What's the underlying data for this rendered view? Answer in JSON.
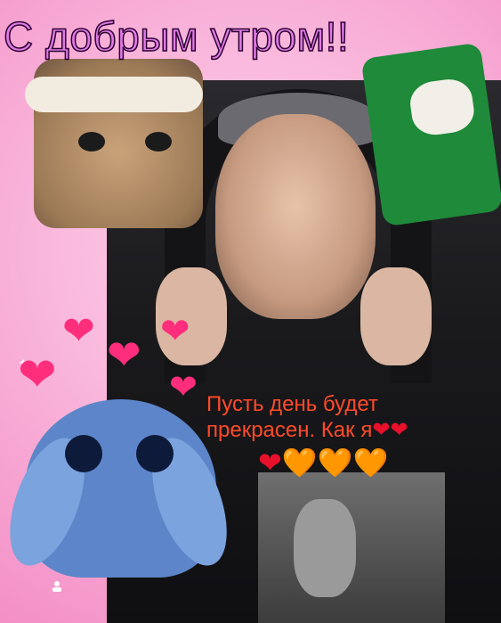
{
  "greeting_title": "С добрым утром!!",
  "caption": {
    "line1": "Пусть день будет",
    "line2": "прекрасен. Как я"
  },
  "hearts": [
    "❤",
    "❤"
  ],
  "emoji_row": [
    "❤",
    "🧡",
    "🧡",
    "🧡"
  ],
  "colors": {
    "title_fill": "#e07ae6",
    "title_stroke": "#2b0030",
    "caption": "#ff4a2a",
    "heart_pink": "#ff2e7d"
  },
  "icons": {
    "profile": "user-icon"
  }
}
